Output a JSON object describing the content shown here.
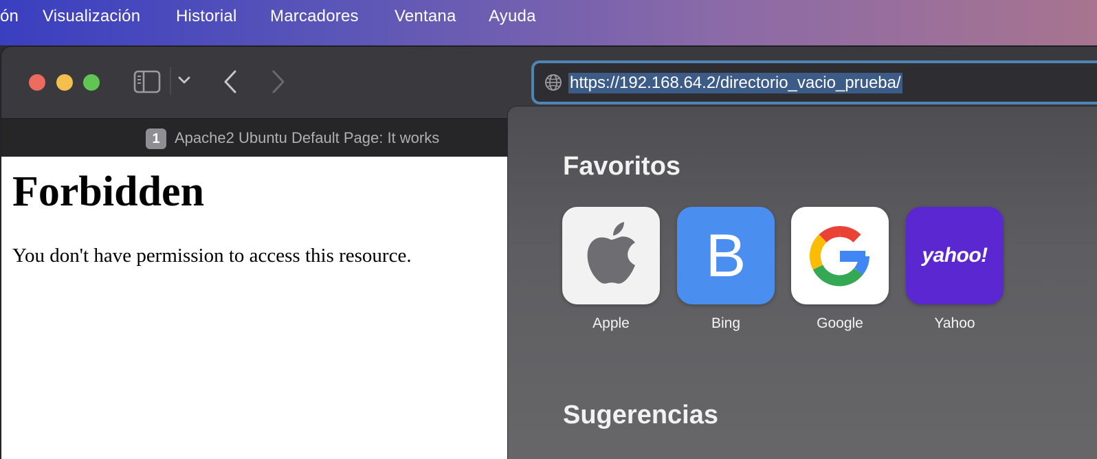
{
  "menubar": {
    "items": [
      "ón",
      "Visualización",
      "Historial",
      "Marcadores",
      "Ventana",
      "Ayuda"
    ]
  },
  "toolbar": {
    "icons": [
      "sidebar-icon",
      "chevron-down-icon",
      "back-icon",
      "forward-icon"
    ],
    "traffic_colors": {
      "close": "#ec6a5e",
      "minimize": "#f4bf4f",
      "zoom": "#61c554"
    }
  },
  "address_bar": {
    "url": "https://192.168.64.2/directorio_vacio_prueba/",
    "icon": "globe-icon",
    "accent": "#4f84b6"
  },
  "tab": {
    "badge": "1",
    "title": "Apache2 Ubuntu Default Page: It works"
  },
  "page": {
    "heading": "Forbidden",
    "message": "You don't have permission to access this resource."
  },
  "favorites": {
    "title": "Favoritos",
    "items": [
      {
        "label": "Apple",
        "icon": "apple-logo-icon",
        "bg": "#f2f2f2"
      },
      {
        "label": "Bing",
        "letter": "B",
        "bg": "#4a8ef0"
      },
      {
        "label": "Google",
        "icon": "google-logo-icon",
        "bg": "#ffffff"
      },
      {
        "label": "Yahoo",
        "wordmark": "yahoo!",
        "bg": "#5b27d0"
      }
    ]
  },
  "suggestions": {
    "title": "Sugerencias"
  }
}
